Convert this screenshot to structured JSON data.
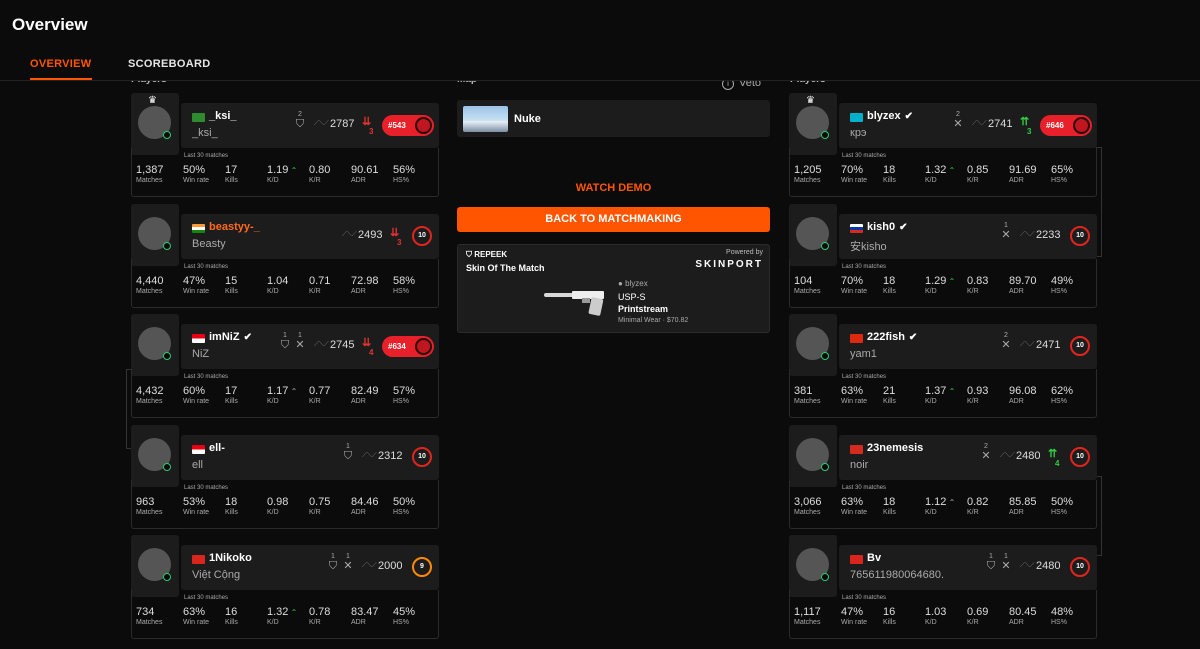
{
  "header": {
    "title": "Overview",
    "tabs": [
      "OVERVIEW",
      "SCOREBOARD"
    ]
  },
  "labels": {
    "players": "Players",
    "map": "Map",
    "veto": "Veto",
    "last30": "Last 30 matches"
  },
  "stat_labels": [
    "Matches",
    "Win rate",
    "Kills",
    "K/D",
    "K/R",
    "ADR",
    "HS%"
  ],
  "map": {
    "name": "Nuke"
  },
  "actions": {
    "watch_demo": "WATCH DEMO",
    "back": "BACK TO MATCHMAKING"
  },
  "skin": {
    "brand": "REPEEK",
    "title": "Skin Of The Match",
    "powered": "Powered by",
    "sponsor": "SKINPORT",
    "owner": "blyzex",
    "weapon": "USP-S",
    "skin_name": "Printstream",
    "condition": "Minimal Wear · $70.82"
  },
  "colors": {
    "accent": "#ff5500",
    "win": "#2ecc40",
    "loss": "#e0332e"
  },
  "team1": [
    {
      "name": "_ksi_",
      "alias": "_ksi_",
      "flag": "green",
      "crown": true,
      "party": [
        {
          "n": "2",
          "g": "shield-icon"
        }
      ],
      "elo": "2787",
      "change": {
        "dir": "down",
        "val": "3"
      },
      "rank": "#543",
      "level": null,
      "stats": {
        "matches": "1,387",
        "winrate": "50%",
        "kills": "17",
        "kd": "1.19",
        "kd_dir": "up",
        "kr": "0.80",
        "adr": "90.61",
        "hs": "56%"
      }
    },
    {
      "name": "beastyy-_",
      "alias": "Beasty",
      "flag": "india",
      "orange": true,
      "party": [],
      "elo": "2493",
      "change": {
        "dir": "down",
        "val": "3"
      },
      "rank": null,
      "level": "10",
      "stats": {
        "matches": "4,440",
        "winrate": "47%",
        "kills": "15",
        "kd": "1.04",
        "kr": "0.71",
        "adr": "72.98",
        "hs": "58%"
      }
    },
    {
      "name": "imNiZ",
      "alias": "NiZ",
      "flag": "indonesia",
      "verified": true,
      "party": [
        {
          "n": "1",
          "g": "shield-icon"
        },
        {
          "n": "1",
          "g": "swords-icon"
        }
      ],
      "elo": "2745",
      "change": {
        "dir": "down",
        "val": "4"
      },
      "rank": "#634",
      "level": null,
      "stats": {
        "matches": "4,432",
        "winrate": "60%",
        "kills": "17",
        "kd": "1.17",
        "kd_dir": "gray",
        "kr": "0.77",
        "adr": "82.49",
        "hs": "57%"
      }
    },
    {
      "name": "ell-",
      "alias": "ell",
      "flag": "indonesia",
      "party": [
        {
          "n": "1",
          "g": "shield-icon"
        }
      ],
      "elo": "2312",
      "rank": null,
      "level": "10",
      "stats": {
        "matches": "963",
        "winrate": "53%",
        "kills": "18",
        "kd": "0.98",
        "kr": "0.75",
        "adr": "84.46",
        "hs": "50%"
      }
    },
    {
      "name": "1Nikoko",
      "alias": "Việt Cộng",
      "flag": "vietnam",
      "party": [
        {
          "n": "1",
          "g": "shield-icon"
        },
        {
          "n": "1",
          "g": "swords-icon"
        }
      ],
      "elo": "2000",
      "rank": null,
      "level": "9",
      "level_orange": true,
      "stats": {
        "matches": "734",
        "winrate": "63%",
        "kills": "16",
        "kd": "1.32",
        "kd_dir": "up",
        "kr": "0.78",
        "adr": "83.47",
        "hs": "45%"
      }
    }
  ],
  "team2": [
    {
      "name": "blyzex",
      "alias": "крэ",
      "flag": "kazakhstan",
      "crown": true,
      "verified": true,
      "party": [
        {
          "n": "2",
          "g": "swords-icon"
        }
      ],
      "elo": "2741",
      "change": {
        "dir": "up",
        "val": "3"
      },
      "rank": "#646",
      "level": null,
      "stats": {
        "matches": "1,205",
        "winrate": "70%",
        "kills": "18",
        "kd": "1.32",
        "kd_dir": "up",
        "kr": "0.85",
        "adr": "91.69",
        "hs": "65%"
      }
    },
    {
      "name": "kish0",
      "alias": "安kisho",
      "flag": "russia",
      "verified": true,
      "party": [
        {
          "n": "1",
          "g": "swords-icon"
        }
      ],
      "elo": "2233",
      "rank": null,
      "level": "10",
      "stats": {
        "matches": "104",
        "winrate": "70%",
        "kills": "18",
        "kd": "1.29",
        "kd_dir": "up",
        "kr": "0.83",
        "adr": "89.70",
        "hs": "49%"
      }
    },
    {
      "name": "222fish",
      "alias": "yam1",
      "flag": "china",
      "verified": true,
      "party": [
        {
          "n": "2",
          "g": "swords-icon"
        }
      ],
      "elo": "2471",
      "rank": null,
      "level": "10",
      "stats": {
        "matches": "381",
        "winrate": "63%",
        "kills": "21",
        "kd": "1.37",
        "kd_dir": "up",
        "kr": "0.93",
        "adr": "96.08",
        "hs": "62%"
      }
    },
    {
      "name": "23nemesis",
      "alias": "noir",
      "flag": "swiss",
      "party": [
        {
          "n": "2",
          "g": "swords-icon"
        }
      ],
      "elo": "2480",
      "change": {
        "dir": "up",
        "val": "4"
      },
      "rank": null,
      "level": "10",
      "stats": {
        "matches": "3,066",
        "winrate": "63%",
        "kills": "18",
        "kd": "1.12",
        "kd_dir": "gray",
        "kr": "0.82",
        "adr": "85.85",
        "hs": "50%"
      }
    },
    {
      "name": "Bv",
      "alias": "765611980064680...",
      "flag": "vietnam",
      "party": [
        {
          "n": "1",
          "g": "shield-icon"
        },
        {
          "n": "1",
          "g": "swords-icon"
        }
      ],
      "elo": "2480",
      "rank": null,
      "level": "10",
      "stats": {
        "matches": "1,117",
        "winrate": "47%",
        "kills": "16",
        "kd": "1.03",
        "kr": "0.69",
        "adr": "80.45",
        "hs": "48%"
      }
    }
  ]
}
